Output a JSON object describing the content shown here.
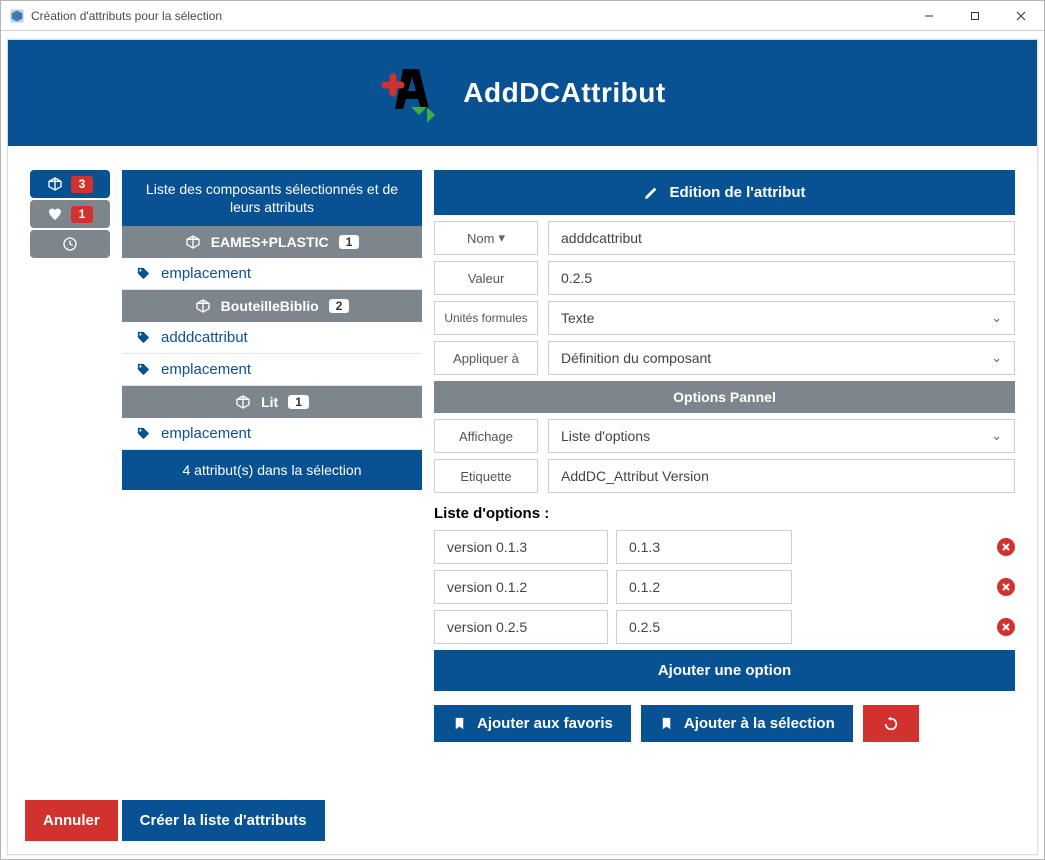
{
  "window_title": "Création d'attributs pour la sélection",
  "header": {
    "title": "AddDCAttribut"
  },
  "sidebar_badges": {
    "cube_count": "3",
    "fav_count": "1"
  },
  "mid": {
    "title": "Liste des composants sélectionnés et de leurs attributs",
    "footer": "4 attribut(s) dans la sélection",
    "components": [
      {
        "name": "EAMES+PLASTIC",
        "count": "1",
        "attrs": [
          "emplacement"
        ]
      },
      {
        "name": "BouteilleBiblio",
        "count": "2",
        "attrs": [
          "adddcattribut",
          "emplacement"
        ]
      },
      {
        "name": "Lit",
        "count": "1",
        "attrs": [
          "emplacement"
        ]
      }
    ]
  },
  "editor": {
    "title": "Edition de l'attribut",
    "labels": {
      "nom": "Nom",
      "valeur": "Valeur",
      "unites": "Unités formules",
      "appliquer": "Appliquer à",
      "options_panel": "Options Pannel",
      "affichage": "Affichage",
      "etiquette": "Etiquette",
      "liste": "Liste d'options :"
    },
    "values": {
      "nom": "adddcattribut",
      "valeur": "0.2.5",
      "unites": "Texte",
      "appliquer": "Définition du composant",
      "affichage": "Liste d'options",
      "etiquette": "AddDC_Attribut Version"
    },
    "options": [
      {
        "label": "version 0.1.3",
        "value": "0.1.3"
      },
      {
        "label": "version 0.1.2",
        "value": "0.1.2"
      },
      {
        "label": "version 0.2.5",
        "value": "0.2.5"
      }
    ],
    "buttons": {
      "add_option": "Ajouter une option",
      "add_fav": "Ajouter aux favoris",
      "add_sel": "Ajouter à la sélection"
    }
  },
  "bottom": {
    "cancel": "Annuler",
    "create": "Créer la liste d'attributs"
  }
}
